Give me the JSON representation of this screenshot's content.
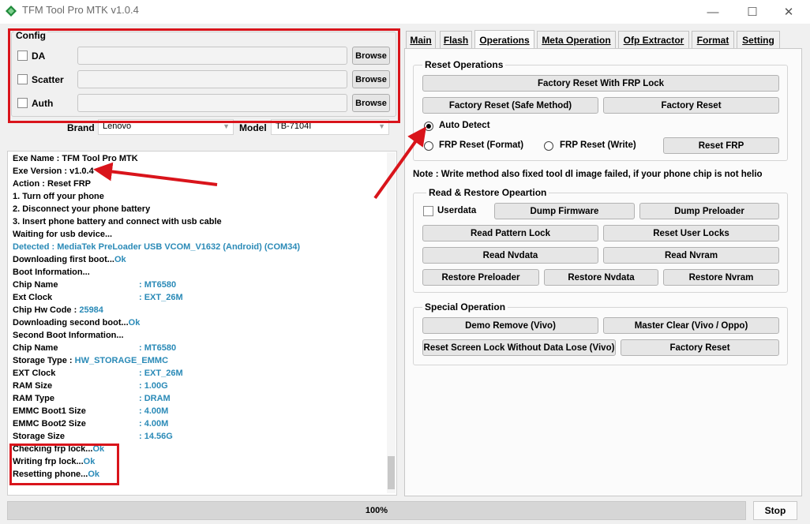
{
  "window": {
    "title": "TFM Tool Pro MTK v1.0.4",
    "minimize": "—",
    "maximize": "☐",
    "close": "✕"
  },
  "config": {
    "legend": "Config",
    "rows": [
      {
        "label": "DA",
        "value": "",
        "button": "Browse"
      },
      {
        "label": "Scatter",
        "value": "",
        "button": "Browse"
      },
      {
        "label": "Auth",
        "value": "",
        "button": "Browse"
      }
    ],
    "brand_label": "Brand",
    "brand_value": "Lenovo",
    "model_label": "Model",
    "model_value": "TB-7104I"
  },
  "log": {
    "lines": [
      {
        "text": "Exe Name : TFM Tool Pro MTK"
      },
      {
        "text": "Exe Version : v1.0.4"
      },
      {
        "text": "Action : Reset FRP"
      },
      {
        "text": "1. Turn off your phone"
      },
      {
        "text": "2. Disconnect your phone battery"
      },
      {
        "text": "3. Insert phone battery and connect with usb cable"
      },
      {
        "text": "Waiting for usb device..."
      },
      {
        "text": "Detected   :   MediaTek PreLoader USB VCOM_V1632 (Android) (COM34)",
        "color": "blue"
      },
      {
        "text": "Downloading first boot...",
        "ok": "Ok"
      },
      {
        "text": "Boot Information..."
      },
      {
        "text": "Chip Name",
        "value": ": MT6580"
      },
      {
        "text": "Ext Clock",
        "value": ": EXT_26M"
      },
      {
        "text": "Chip Hw Code : ",
        "inline": "25984"
      },
      {
        "text": "Downloading second boot...",
        "ok": "Ok"
      },
      {
        "text": "Second Boot Information..."
      },
      {
        "text": "Chip Name",
        "value": ": MT6580"
      },
      {
        "text": "Storage Type : ",
        "inline": "HW_STORAGE_EMMC"
      },
      {
        "text": "EXT Clock",
        "value": ": EXT_26M"
      },
      {
        "text": "RAM Size",
        "value": ": 1.00G"
      },
      {
        "text": "RAM Type",
        "value": ": DRAM"
      },
      {
        "text": "EMMC Boot1 Size",
        "value": ": 4.00M"
      },
      {
        "text": "EMMC Boot2 Size",
        "value": ": 4.00M"
      },
      {
        "text": "Storage Size",
        "value": ": 14.56G"
      },
      {
        "text": "Checking frp lock...",
        "ok": "Ok"
      },
      {
        "text": "Writing frp lock...",
        "ok": "Ok"
      },
      {
        "text": "Resetting phone...",
        "ok": "Ok"
      }
    ]
  },
  "tabs": [
    {
      "label": "Main"
    },
    {
      "label": "Flash"
    },
    {
      "label": "Operations",
      "active": true
    },
    {
      "label": "Meta Operation"
    },
    {
      "label": "Ofp Extractor"
    },
    {
      "label": "Format"
    },
    {
      "label": "Setting"
    }
  ],
  "reset_operations": {
    "legend": "Reset Operations",
    "factory_reset_frp": "Factory Reset With FRP Lock",
    "factory_reset_safe": "Factory Reset (Safe Method)",
    "factory_reset": "Factory Reset",
    "auto_detect": "Auto Detect",
    "frp_format": "FRP Reset (Format)",
    "frp_write": "FRP Reset (Write)",
    "reset_frp": "Reset FRP",
    "selected": "Auto Detect"
  },
  "note": "Note : Write method also fixed tool dl image failed, if your phone chip is not helio",
  "read_restore": {
    "legend": "Read & Restore Opeartion",
    "userdata": "Userdata",
    "dump_firmware": "Dump Firmware",
    "dump_preloader": "Dump Preloader",
    "read_pattern_lock": "Read Pattern Lock",
    "reset_user_locks": "Reset User Locks",
    "read_nvdata": "Read Nvdata",
    "read_nvram": "Read Nvram",
    "restore_preloader": "Restore Preloader",
    "restore_nvdata": "Restore Nvdata",
    "restore_nvram": "Restore Nvram"
  },
  "special": {
    "legend": "Special Operation",
    "demo_remove": "Demo Remove (Vivo)",
    "master_clear": "Master Clear (Vivo / Oppo)",
    "reset_screen_lock": "Reset Screen Lock Without Data Lose (Vivo)",
    "factory_reset": "Factory Reset"
  },
  "progress": {
    "label": "100%",
    "value": 1.0
  },
  "stop_label": "Stop",
  "colors": {
    "annotation_red": "#d9141b",
    "log_blue": "#2a8ab7",
    "icon_green": "#1f8a3a"
  }
}
